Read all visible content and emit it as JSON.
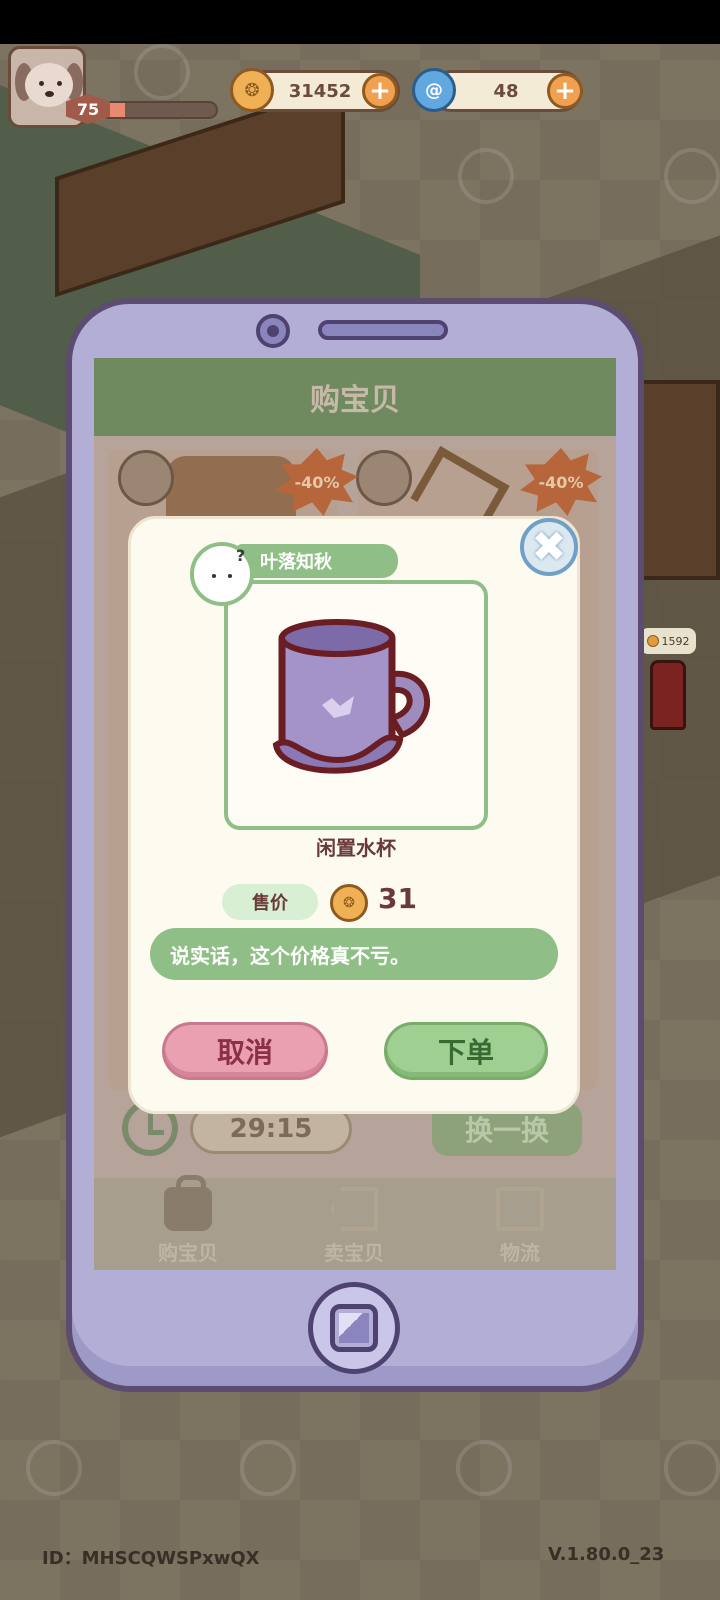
{
  "hud": {
    "level": "75",
    "xp_fraction": 0.2,
    "coins": "31452",
    "gems": "48"
  },
  "background": {
    "mailbox_coins": "1592"
  },
  "phone": {
    "screen_title": "购宝贝",
    "discount_a": "-40%",
    "discount_b": "-40%",
    "timer": "29:15",
    "refresh_label": "换一换",
    "nav": [
      {
        "label": "购宝贝",
        "icon": "shopping-bag-icon"
      },
      {
        "label": "卖宝贝",
        "icon": "price-tag-icon"
      },
      {
        "label": "物流",
        "icon": "package-box-icon"
      }
    ]
  },
  "dialog": {
    "seller_name": "叶落知秋",
    "seller_mark": "?",
    "item_name": "闲置水杯",
    "price_label": "售价",
    "price_value": "31",
    "comment": "说实话，这个价格真不亏。",
    "cancel_label": "取消",
    "order_label": "下单",
    "close_symbol": "✖"
  },
  "footer": {
    "id_text": "ID：MHSCQWSPxwQX",
    "version_text": "V.1.80.0_23"
  },
  "colors": {
    "accent_green": "#8fbf86",
    "cancel_pink": "#eaa0b0",
    "phone_purple": "#b2aed6",
    "coin_orange": "#f0b055"
  }
}
